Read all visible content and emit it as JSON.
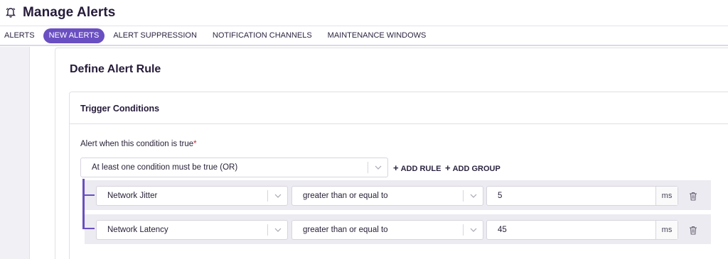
{
  "header": {
    "title": "Manage Alerts",
    "icon": "bell-icon"
  },
  "tabs": [
    {
      "label": "ALERTS",
      "active": false
    },
    {
      "label": "NEW ALERTS",
      "active": true
    },
    {
      "label": "ALERT SUPPRESSION",
      "active": false
    },
    {
      "label": "NOTIFICATION CHANNELS",
      "active": false
    },
    {
      "label": "MAINTENANCE WINDOWS",
      "active": false
    }
  ],
  "card": {
    "title": "Define Alert Rule"
  },
  "trigger": {
    "section_title": "Trigger Conditions",
    "condition_label": "Alert when this condition is true",
    "required_mark": "*",
    "combinator": "At least one condition must be true (OR)",
    "add_rule_label": "ADD RULE",
    "add_group_label": "ADD GROUP",
    "rules": [
      {
        "metric": "Network Jitter",
        "operator": "greater than or equal to",
        "value": "5",
        "unit": "ms"
      },
      {
        "metric": "Network Latency",
        "operator": "greater than or equal to",
        "value": "45",
        "unit": "ms"
      }
    ]
  },
  "colors": {
    "accent": "#6a4fc2",
    "required": "#d0253a",
    "row_bg": "#ecebf1"
  }
}
